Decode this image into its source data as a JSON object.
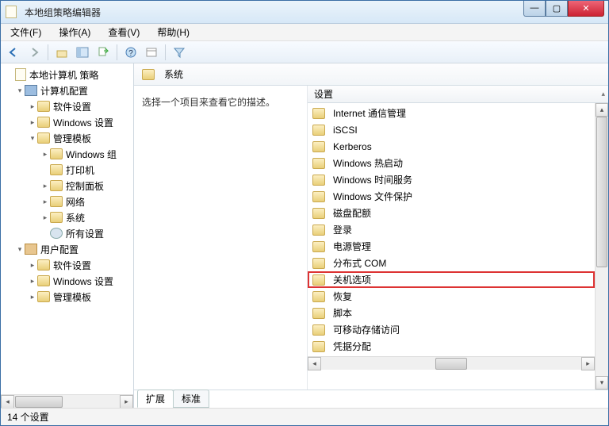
{
  "title": "本地组策略编辑器",
  "menus": {
    "file": "文件(F)",
    "action": "操作(A)",
    "view": "查看(V)",
    "help": "帮助(H)"
  },
  "tree": {
    "root": "本地计算机 策略",
    "computer": "计算机配置",
    "software1": "软件设置",
    "windows1": "Windows 设置",
    "admin1": "管理模板",
    "wincomp": "Windows 组",
    "printer": "打印机",
    "controlpanel": "控制面板",
    "network": "网络",
    "system": "系统",
    "allsettings": "所有设置",
    "user": "用户配置",
    "software2": "软件设置",
    "windows2": "Windows 设置",
    "admin2": "管理模板"
  },
  "header": "系统",
  "desc": "选择一个项目来查看它的描述。",
  "colheader": "设置",
  "items": [
    "Internet 通信管理",
    "iSCSI",
    "Kerberos",
    "Windows 热启动",
    "Windows 时间服务",
    "Windows 文件保护",
    "磁盘配额",
    "登录",
    "电源管理",
    "分布式 COM",
    "关机选项",
    "恢复",
    "脚本",
    "可移动存储访问",
    "凭据分配"
  ],
  "highlight_index": 10,
  "tabs": {
    "extended": "扩展",
    "standard": "标准"
  },
  "status": "14 个设置"
}
